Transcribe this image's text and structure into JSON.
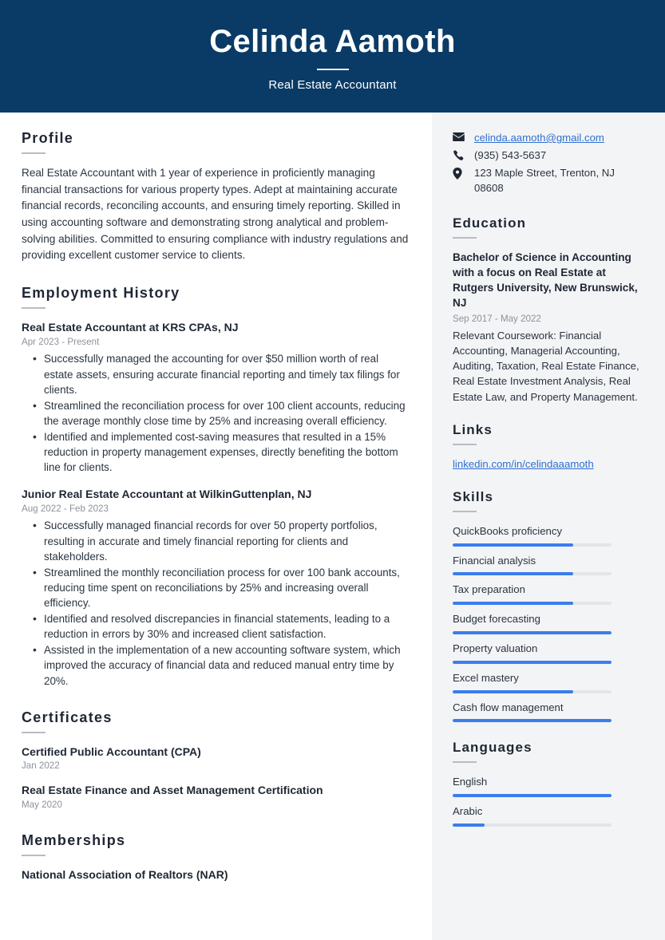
{
  "theme": {
    "header_bg": "#0a3b66",
    "sidebar_bg": "#f3f4f6",
    "accent": "#3b7ded",
    "link": "#2f6fd0",
    "muted_text": "#8d929b",
    "body_text": "#2b3440"
  },
  "header": {
    "name": "Celinda Aamoth",
    "job_title": "Real Estate Accountant"
  },
  "main": {
    "profile": {
      "heading": "Profile",
      "text": "Real Estate Accountant with 1 year of experience in proficiently managing financial transactions for various property types. Adept at maintaining accurate financial records, reconciling accounts, and ensuring timely reporting. Skilled in using accounting software and demonstrating strong analytical and problem-solving abilities. Committed to ensuring compliance with industry regulations and providing excellent customer service to clients."
    },
    "employment": {
      "heading": "Employment History",
      "jobs": [
        {
          "title": "Real Estate Accountant at KRS CPAs, NJ",
          "dates": "Apr 2023 - Present",
          "bullets": [
            "Successfully managed the accounting for over $50 million worth of real estate assets, ensuring accurate financial reporting and timely tax filings for clients.",
            "Streamlined the reconciliation process for over 100 client accounts, reducing the average monthly close time by 25% and increasing overall efficiency.",
            "Identified and implemented cost-saving measures that resulted in a 15% reduction in property management expenses, directly benefiting the bottom line for clients."
          ]
        },
        {
          "title": "Junior Real Estate Accountant at WilkinGuttenplan, NJ",
          "dates": "Aug 2022 - Feb 2023",
          "bullets": [
            "Successfully managed financial records for over 50 property portfolios, resulting in accurate and timely financial reporting for clients and stakeholders.",
            "Streamlined the monthly reconciliation process for over 100 bank accounts, reducing time spent on reconciliations by 25% and increasing overall efficiency.",
            "Identified and resolved discrepancies in financial statements, leading to a reduction in errors by 30% and increased client satisfaction.",
            "Assisted in the implementation of a new accounting software system, which improved the accuracy of financial data and reduced manual entry time by 20%."
          ]
        }
      ]
    },
    "certificates": {
      "heading": "Certificates",
      "items": [
        {
          "title": "Certified Public Accountant (CPA)",
          "date": "Jan 2022"
        },
        {
          "title": "Real Estate Finance and Asset Management Certification",
          "date": "May 2020"
        }
      ]
    },
    "memberships": {
      "heading": "Memberships",
      "items": [
        {
          "title": "National Association of Realtors (NAR)"
        }
      ]
    }
  },
  "sidebar": {
    "contact": [
      {
        "icon": "envelope-icon",
        "value": "celinda.aamoth@gmail.com",
        "is_link": true
      },
      {
        "icon": "phone-icon",
        "value": "(935) 543-5637",
        "is_link": false
      },
      {
        "icon": "map-pin-icon",
        "value": "123 Maple Street, Trenton, NJ 08608",
        "is_link": false
      }
    ],
    "education": {
      "heading": "Education",
      "degree": "Bachelor of Science in Accounting with a focus on Real Estate at Rutgers University, New Brunswick, NJ",
      "dates": "Sep 2017 - May 2022",
      "description": "Relevant Coursework: Financial Accounting, Managerial Accounting, Auditing, Taxation, Real Estate Finance, Real Estate Investment Analysis, Real Estate Law, and Property Management."
    },
    "links": {
      "heading": "Links",
      "items": [
        {
          "label": "linkedin.com/in/celindaaamoth"
        }
      ]
    },
    "skills": {
      "heading": "Skills",
      "items": [
        {
          "label": "QuickBooks proficiency",
          "level": 76
        },
        {
          "label": "Financial analysis",
          "level": 76
        },
        {
          "label": "Tax preparation",
          "level": 76
        },
        {
          "label": "Budget forecasting",
          "level": 100
        },
        {
          "label": "Property valuation",
          "level": 100
        },
        {
          "label": "Excel mastery",
          "level": 76
        },
        {
          "label": "Cash flow management",
          "level": 100
        }
      ]
    },
    "languages": {
      "heading": "Languages",
      "items": [
        {
          "label": "English",
          "level": 100
        },
        {
          "label": "Arabic",
          "level": 20
        }
      ]
    }
  }
}
